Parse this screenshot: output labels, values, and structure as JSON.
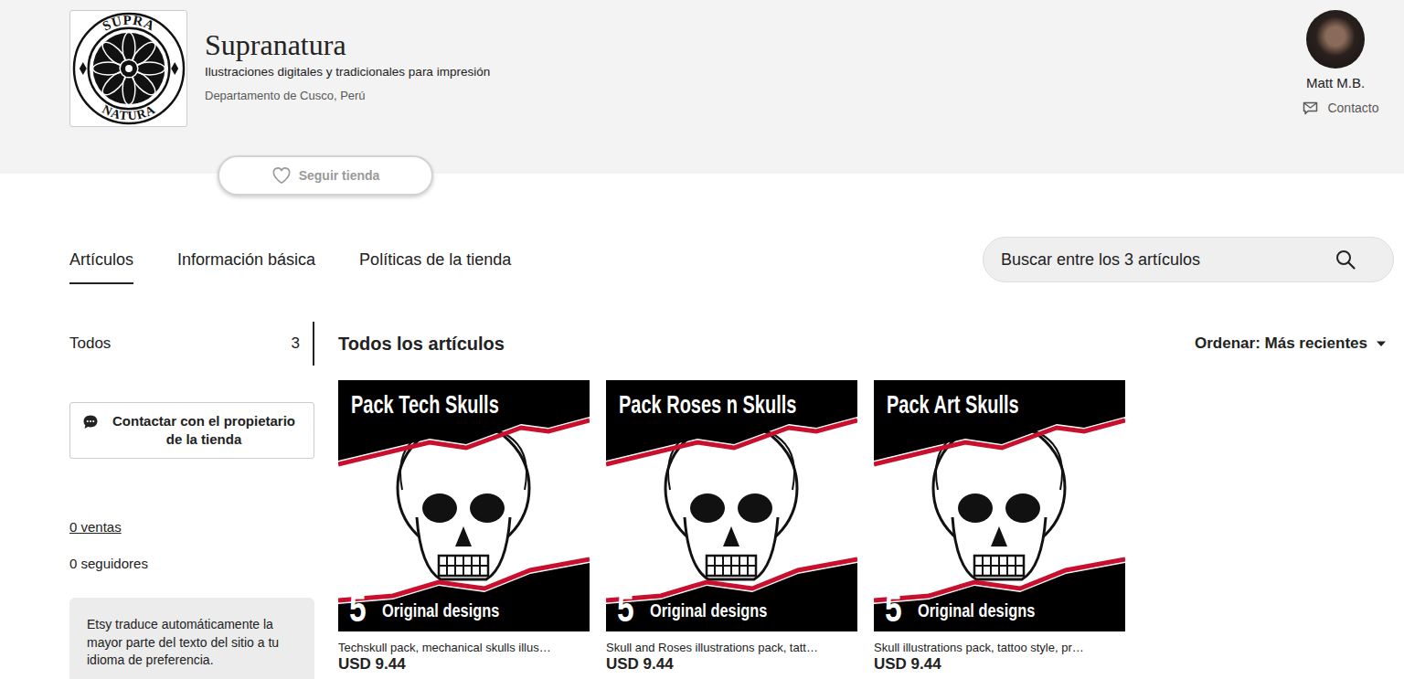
{
  "shop": {
    "name": "Supranatura",
    "tagline": "Ilustraciones digitales y tradicionales para impresión",
    "location": "Departamento de Cusco, Perú",
    "logo_top": "SUPRA",
    "logo_bottom": "NATURA",
    "follow_button": "Seguir tienda"
  },
  "owner": {
    "name": "Matt M.B.",
    "contact": "Contacto"
  },
  "tabs": [
    {
      "label": "Artículos",
      "selected": true
    },
    {
      "label": "Información básica",
      "selected": false
    },
    {
      "label": "Políticas de la tienda",
      "selected": false
    }
  ],
  "search": {
    "placeholder": "Buscar entre los 3 artículos"
  },
  "sidebar": {
    "sections": [
      {
        "label": "Todos",
        "count": "3",
        "selected": true
      }
    ],
    "contact_button": "Contactar con el propietario de la tienda",
    "sales": "0 ventas",
    "followers": "0 seguidores",
    "notice": "Etsy traduce automáticamente la mayor parte del texto del sitio a tu idioma de preferencia."
  },
  "listing": {
    "title": "Todos los artículos",
    "sort": "Ordenar: Más recientes"
  },
  "products": [
    {
      "image_title": "Pack Tech Skulls",
      "image_count": "5",
      "image_caption": "Original designs",
      "title": "Techskull pack, mechanical skulls illus…",
      "price": "USD 9.44"
    },
    {
      "image_title": "Pack Roses n Skulls",
      "image_count": "5",
      "image_caption": "Original designs",
      "title": "Skull and Roses illustrations pack, tatt…",
      "price": "USD 9.44"
    },
    {
      "image_title": "Pack Art Skulls",
      "image_count": "5",
      "image_caption": "Original designs",
      "title": "Skull illustrations pack, tattoo style, pr…",
      "price": "USD 9.44"
    }
  ]
}
